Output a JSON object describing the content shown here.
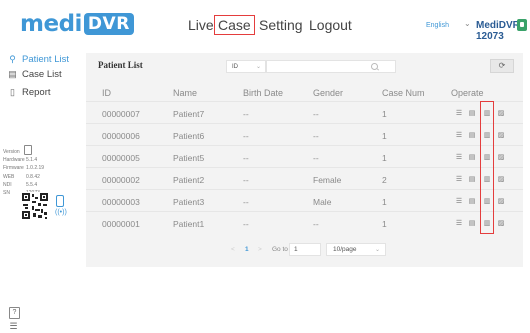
{
  "header": {
    "logo": {
      "text_a": "medi",
      "text_b": "DVR"
    },
    "nav": [
      "Live",
      "Case",
      "Setting",
      "Logout"
    ],
    "active_nav": "Case",
    "language": "English",
    "user": "MediDVR-12073"
  },
  "sidebar": {
    "items": [
      {
        "label": "Patient List",
        "icon": "person-icon",
        "active": true
      },
      {
        "label": "Case List",
        "icon": "list-icon",
        "active": false
      },
      {
        "label": "Report",
        "icon": "report-icon",
        "active": false
      }
    ],
    "info": [
      {
        "key": "Version",
        "value": ""
      },
      {
        "key": "Hardware",
        "value": "5.1.4"
      },
      {
        "key": "Firmware",
        "value": "1.0.2.19"
      },
      {
        "key": "WEB",
        "value": "0.8.42"
      },
      {
        "key": "NDI",
        "value": "5.5.4"
      },
      {
        "key": "SN",
        "value": "12073"
      }
    ]
  },
  "main": {
    "title": "Patient List",
    "filter_value": "ID",
    "search_placeholder": "",
    "refresh_label": "⟳",
    "columns": [
      "ID",
      "Name",
      "Birth Date",
      "Gender",
      "Case Num",
      "Operate"
    ],
    "rows": [
      {
        "id": "00000007",
        "name": "Patient7",
        "birth": "--",
        "gender": "--",
        "cases": "1"
      },
      {
        "id": "00000006",
        "name": "Patient6",
        "birth": "--",
        "gender": "--",
        "cases": "1"
      },
      {
        "id": "00000005",
        "name": "Patient5",
        "birth": "--",
        "gender": "--",
        "cases": "1"
      },
      {
        "id": "00000002",
        "name": "Patient2",
        "birth": "--",
        "gender": "Female",
        "cases": "2"
      },
      {
        "id": "00000003",
        "name": "Patient3",
        "birth": "--",
        "gender": "Male",
        "cases": "1"
      },
      {
        "id": "00000001",
        "name": "Patient1",
        "birth": "--",
        "gender": "--",
        "cases": "1"
      }
    ],
    "pagination": {
      "prev": "<",
      "current": "1",
      "next": ">",
      "goto_label": "Go to",
      "goto_value": "1",
      "page_size": "10/page"
    }
  }
}
